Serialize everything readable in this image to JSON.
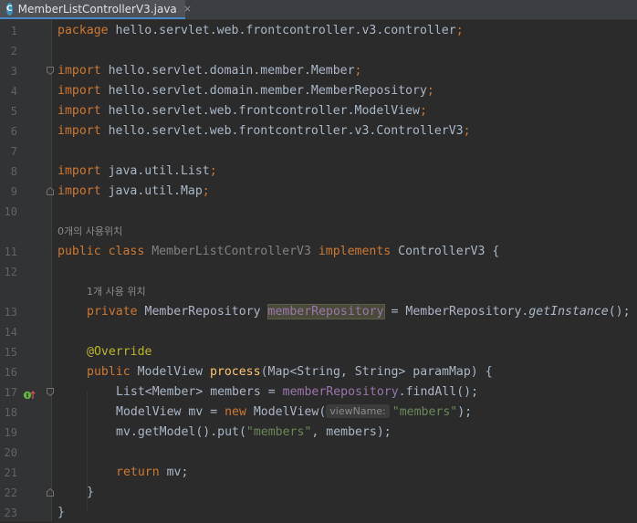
{
  "tab": {
    "filename": "MemberListControllerV3.java",
    "file_icon": "java-class-icon",
    "close_glyph": "×"
  },
  "line_numbers": [
    "1",
    "2",
    "3",
    "4",
    "5",
    "6",
    "7",
    "8",
    "9",
    "10",
    "11",
    "12",
    "13",
    "14",
    "15",
    "16",
    "17",
    "18",
    "19",
    "20",
    "21",
    "22",
    "23"
  ],
  "hints": {
    "class_usages": "0개의 사용위치",
    "field_usages": "1개 사용 위치",
    "param_name": "viewName:"
  },
  "code": {
    "l1_kw": "package",
    "l1_rest": " hello.servlet.web.frontcontroller.v3.controller",
    "semi": ";",
    "import_kw": "import",
    "l3": " hello.servlet.domain.member.Member",
    "l4": " hello.servlet.domain.member.MemberRepository",
    "l5": " hello.servlet.web.frontcontroller.ModelView",
    "l6": " hello.servlet.web.frontcontroller.v3.ControllerV3",
    "l8": " java.util.List",
    "l9": " java.util.Map",
    "public_class": "public class ",
    "class_name": "MemberListControllerV3",
    "implements": " implements ",
    "iface": "ControllerV3 {",
    "private": "private ",
    "repo_type": "MemberRepository ",
    "repo_field": "memberRepository",
    "repo_assign": " = MemberRepository.",
    "get_instance": "getInstance",
    "call_end": "();",
    "override": "@Override",
    "public": "public ",
    "mv_type": "ModelView ",
    "process": "process",
    "process_params": "(Map<String, String> paramMap) {",
    "l17_a": "List<Member> members = ",
    "l17_b": ".findAll();",
    "l18_a": "ModelView mv = ",
    "new": "new",
    "l18_b": " ModelView(",
    "str_members": "\"members\"",
    "l18_c": ");",
    "l19_a": "mv.getModel().put(",
    "l19_b": ", members);",
    "return": "return",
    "l21_b": " mv;",
    "close_method": "}",
    "close_class": "}"
  },
  "colors": {
    "background": "#2b2b2b",
    "keyword": "#cc7832",
    "field": "#9876aa",
    "method_decl": "#ffc66d",
    "string": "#6a8759",
    "annotation": "#bbb529",
    "default_text": "#a9b7c6"
  }
}
